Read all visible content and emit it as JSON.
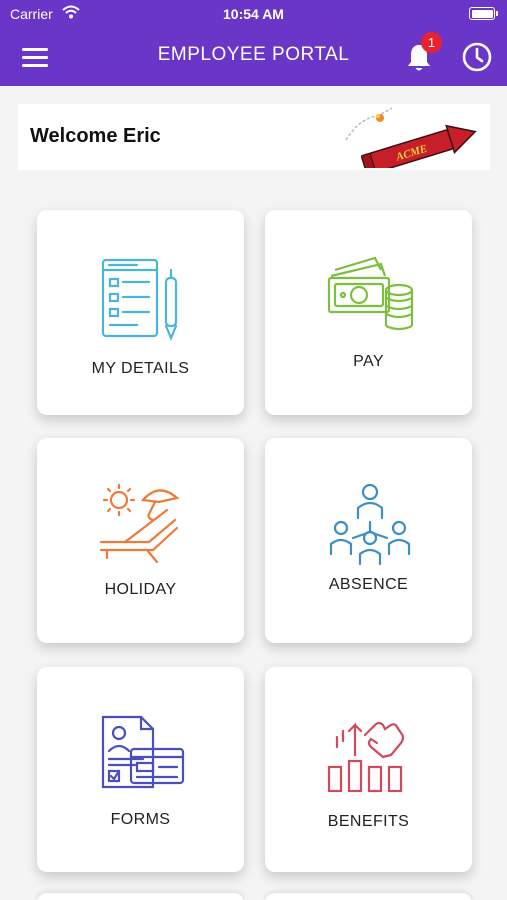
{
  "status_bar": {
    "carrier": "Carrier",
    "time": "10:54 AM"
  },
  "header": {
    "title": "EMPLOYEE PORTAL",
    "notification_count": "1",
    "accent": "#6a36c7"
  },
  "welcome": {
    "text": "Welcome Eric",
    "logo_text": "ACME"
  },
  "tiles": [
    {
      "label": "MY DETAILS",
      "icon": "form-document-pen-icon",
      "color": "#4ab5d6"
    },
    {
      "label": "PAY",
      "icon": "money-coins-icon",
      "color": "#7cbf3e"
    },
    {
      "label": "HOLIDAY",
      "icon": "beach-sunbed-icon",
      "color": "#ef7a38"
    },
    {
      "label": "ABSENCE",
      "icon": "people-hierarchy-icon",
      "color": "#3c8ec4"
    },
    {
      "label": "FORMS",
      "icon": "id-card-forms-icon",
      "color": "#4a4fc0"
    },
    {
      "label": "BENEFITS",
      "icon": "hand-growth-chart-icon",
      "color": "#d04a5c"
    }
  ]
}
